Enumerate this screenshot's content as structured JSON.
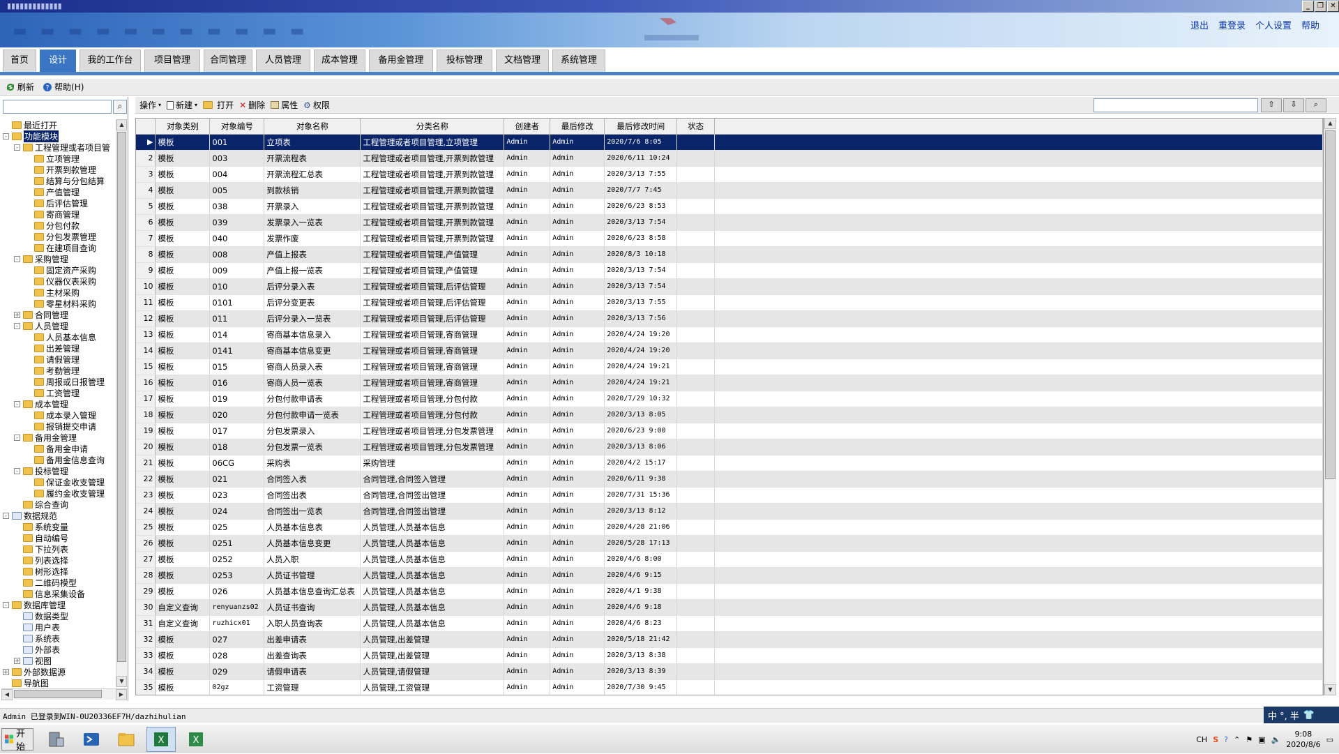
{
  "window": {
    "minimize": "_",
    "restore": "❐",
    "close": "✕"
  },
  "header": {
    "links": [
      "退出",
      "重登录",
      "个人设置",
      "帮助"
    ]
  },
  "nav": {
    "tabs": [
      "首页",
      "设计",
      "我的工作台",
      "项目管理",
      "合同管理",
      "人员管理",
      "成本管理",
      "备用金管理",
      "投标管理",
      "文档管理",
      "系统管理"
    ],
    "active": 1
  },
  "toolbar": {
    "refresh": "刷新",
    "help": "帮助(H)"
  },
  "toolbar2": {
    "operate": "操作",
    "new": "新建",
    "open": "打开",
    "delete": "删除",
    "props": "属性",
    "perm": "权限"
  },
  "tree": [
    {
      "label": "最近打开",
      "level": 0,
      "tw": "none",
      "type": "folder"
    },
    {
      "label": "功能模块",
      "level": 0,
      "tw": "-",
      "type": "folder",
      "sel": true
    },
    {
      "label": "工程管理或者项目管",
      "level": 1,
      "tw": "-",
      "type": "folder"
    },
    {
      "label": "立项管理",
      "level": 2,
      "tw": "none",
      "type": "folder"
    },
    {
      "label": "开票到款管理",
      "level": 2,
      "tw": "none",
      "type": "folder"
    },
    {
      "label": "结算与分包结算",
      "level": 2,
      "tw": "none",
      "type": "folder"
    },
    {
      "label": "产值管理",
      "level": 2,
      "tw": "none",
      "type": "folder"
    },
    {
      "label": "后评估管理",
      "level": 2,
      "tw": "none",
      "type": "folder"
    },
    {
      "label": "寄商管理",
      "level": 2,
      "tw": "none",
      "type": "folder"
    },
    {
      "label": "分包付款",
      "level": 2,
      "tw": "none",
      "type": "folder"
    },
    {
      "label": "分包发票管理",
      "level": 2,
      "tw": "none",
      "type": "folder"
    },
    {
      "label": "在建项目查询",
      "level": 2,
      "tw": "none",
      "type": "folder"
    },
    {
      "label": "采购管理",
      "level": 1,
      "tw": "-",
      "type": "folder"
    },
    {
      "label": "固定资产采购",
      "level": 2,
      "tw": "none",
      "type": "folder"
    },
    {
      "label": "仪器仪表采购",
      "level": 2,
      "tw": "none",
      "type": "folder"
    },
    {
      "label": "主材采购",
      "level": 2,
      "tw": "none",
      "type": "folder"
    },
    {
      "label": "零星材料采购",
      "level": 2,
      "tw": "none",
      "type": "folder"
    },
    {
      "label": "合同管理",
      "level": 1,
      "tw": "+",
      "type": "folder"
    },
    {
      "label": "人员管理",
      "level": 1,
      "tw": "-",
      "type": "folder"
    },
    {
      "label": "人员基本信息",
      "level": 2,
      "tw": "none",
      "type": "folder"
    },
    {
      "label": "出差管理",
      "level": 2,
      "tw": "none",
      "type": "folder"
    },
    {
      "label": "请假管理",
      "level": 2,
      "tw": "none",
      "type": "folder"
    },
    {
      "label": "考勤管理",
      "level": 2,
      "tw": "none",
      "type": "folder"
    },
    {
      "label": "周报或日报管理",
      "level": 2,
      "tw": "none",
      "type": "folder"
    },
    {
      "label": "工资管理",
      "level": 2,
      "tw": "none",
      "type": "folder"
    },
    {
      "label": "成本管理",
      "level": 1,
      "tw": "-",
      "type": "folder"
    },
    {
      "label": "成本录入管理",
      "level": 2,
      "tw": "none",
      "type": "folder"
    },
    {
      "label": "报销提交申请",
      "level": 2,
      "tw": "none",
      "type": "folder"
    },
    {
      "label": "备用金管理",
      "level": 1,
      "tw": "-",
      "type": "folder"
    },
    {
      "label": "备用金申请",
      "level": 2,
      "tw": "none",
      "type": "folder"
    },
    {
      "label": "备用金信息查询",
      "level": 2,
      "tw": "none",
      "type": "folder"
    },
    {
      "label": "投标管理",
      "level": 1,
      "tw": "-",
      "type": "folder"
    },
    {
      "label": "保证金收支管理",
      "level": 2,
      "tw": "none",
      "type": "folder"
    },
    {
      "label": "履约金收支管理",
      "level": 2,
      "tw": "none",
      "type": "folder"
    },
    {
      "label": "综合查询",
      "level": 1,
      "tw": "none",
      "type": "folder"
    },
    {
      "label": "数据规范",
      "level": 0,
      "tw": "-",
      "type": "doc"
    },
    {
      "label": "系统变量",
      "level": 1,
      "tw": "none",
      "type": "folder"
    },
    {
      "label": "自动编号",
      "level": 1,
      "tw": "none",
      "type": "folder"
    },
    {
      "label": "下拉列表",
      "level": 1,
      "tw": "none",
      "type": "folder"
    },
    {
      "label": "列表选择",
      "level": 1,
      "tw": "none",
      "type": "folder"
    },
    {
      "label": "树形选择",
      "level": 1,
      "tw": "none",
      "type": "folder"
    },
    {
      "label": "二维码模型",
      "level": 1,
      "tw": "none",
      "type": "folder"
    },
    {
      "label": "信息采集设备",
      "level": 1,
      "tw": "none",
      "type": "folder"
    },
    {
      "label": "数据库管理",
      "level": 0,
      "tw": "-",
      "type": "folder"
    },
    {
      "label": "数据类型",
      "level": 1,
      "tw": "none",
      "type": "doc"
    },
    {
      "label": "用户表",
      "level": 1,
      "tw": "none",
      "type": "doc"
    },
    {
      "label": "系统表",
      "level": 1,
      "tw": "none",
      "type": "doc"
    },
    {
      "label": "外部表",
      "level": 1,
      "tw": "none",
      "type": "doc"
    },
    {
      "label": "视图",
      "level": 1,
      "tw": "+",
      "type": "doc"
    },
    {
      "label": "外部数据源",
      "level": 0,
      "tw": "+",
      "type": "folder"
    },
    {
      "label": "导航图",
      "level": 0,
      "tw": "none",
      "type": "folder"
    }
  ],
  "table": {
    "columns": [
      "对象类别",
      "对象编号",
      "对象名称",
      "分类名称",
      "创建者",
      "最后修改",
      "最后修改时间",
      "状态"
    ],
    "rows": [
      [
        "模板",
        "001",
        "立项表",
        "工程管理或者项目管理,立项管理",
        "Admin",
        "Admin",
        "2020/7/6 8:05",
        ""
      ],
      [
        "模板",
        "003",
        "开票流程表",
        "工程管理或者项目管理,开票到款管理",
        "Admin",
        "Admin",
        "2020/6/11 10:24",
        ""
      ],
      [
        "模板",
        "004",
        "开票流程汇总表",
        "工程管理或者项目管理,开票到款管理",
        "Admin",
        "Admin",
        "2020/3/13 7:55",
        ""
      ],
      [
        "模板",
        "005",
        "到款核销",
        "工程管理或者项目管理,开票到款管理",
        "Admin",
        "Admin",
        "2020/7/7 7:45",
        ""
      ],
      [
        "模板",
        "038",
        "开票录入",
        "工程管理或者项目管理,开票到款管理",
        "Admin",
        "Admin",
        "2020/6/23 8:53",
        ""
      ],
      [
        "模板",
        "039",
        "发票录入一览表",
        "工程管理或者项目管理,开票到款管理",
        "Admin",
        "Admin",
        "2020/3/13 7:54",
        ""
      ],
      [
        "模板",
        "040",
        "发票作废",
        "工程管理或者项目管理,开票到款管理",
        "Admin",
        "Admin",
        "2020/6/23 8:58",
        ""
      ],
      [
        "模板",
        "008",
        "产值上报表",
        "工程管理或者项目管理,产值管理",
        "Admin",
        "Admin",
        "2020/8/3 10:18",
        ""
      ],
      [
        "模板",
        "009",
        "产值上报一览表",
        "工程管理或者项目管理,产值管理",
        "Admin",
        "Admin",
        "2020/3/13 7:54",
        ""
      ],
      [
        "模板",
        "010",
        "后评分录入表",
        "工程管理或者项目管理,后评估管理",
        "Admin",
        "Admin",
        "2020/3/13 7:54",
        ""
      ],
      [
        "模板",
        "0101",
        "后评分变更表",
        "工程管理或者项目管理,后评估管理",
        "Admin",
        "Admin",
        "2020/3/13 7:55",
        ""
      ],
      [
        "模板",
        "011",
        "后评分录入一览表",
        "工程管理或者项目管理,后评估管理",
        "Admin",
        "Admin",
        "2020/3/13 7:56",
        ""
      ],
      [
        "模板",
        "014",
        "寄商基本信息录入",
        "工程管理或者项目管理,寄商管理",
        "Admin",
        "Admin",
        "2020/4/24 19:20",
        ""
      ],
      [
        "模板",
        "0141",
        "寄商基本信息变更",
        "工程管理或者项目管理,寄商管理",
        "Admin",
        "Admin",
        "2020/4/24 19:20",
        ""
      ],
      [
        "模板",
        "015",
        "寄商人员录入表",
        "工程管理或者项目管理,寄商管理",
        "Admin",
        "Admin",
        "2020/4/24 19:21",
        ""
      ],
      [
        "模板",
        "016",
        "寄商人员一览表",
        "工程管理或者项目管理,寄商管理",
        "Admin",
        "Admin",
        "2020/4/24 19:21",
        ""
      ],
      [
        "模板",
        "019",
        "分包付款申请表",
        "工程管理或者项目管理,分包付款",
        "Admin",
        "Admin",
        "2020/7/29 10:32",
        ""
      ],
      [
        "模板",
        "020",
        "分包付款申请一览表",
        "工程管理或者项目管理,分包付款",
        "Admin",
        "Admin",
        "2020/3/13 8:05",
        ""
      ],
      [
        "模板",
        "017",
        "分包发票录入",
        "工程管理或者项目管理,分包发票管理",
        "Admin",
        "Admin",
        "2020/6/23 9:00",
        ""
      ],
      [
        "模板",
        "018",
        "分包发票一览表",
        "工程管理或者项目管理,分包发票管理",
        "Admin",
        "Admin",
        "2020/3/13 8:06",
        ""
      ],
      [
        "模板",
        "06CG",
        "采购表",
        "采购管理",
        "Admin",
        "Admin",
        "2020/4/2 15:17",
        ""
      ],
      [
        "模板",
        "021",
        "合同签入表",
        "合同管理,合同签入管理",
        "Admin",
        "Admin",
        "2020/6/11 9:38",
        ""
      ],
      [
        "模板",
        "023",
        "合同签出表",
        "合同管理,合同签出管理",
        "Admin",
        "Admin",
        "2020/7/31 15:36",
        ""
      ],
      [
        "模板",
        "024",
        "合同签出一览表",
        "合同管理,合同签出管理",
        "Admin",
        "Admin",
        "2020/3/13 8:12",
        ""
      ],
      [
        "模板",
        "025",
        "人员基本信息表",
        "人员管理,人员基本信息",
        "Admin",
        "Admin",
        "2020/4/28 21:06",
        ""
      ],
      [
        "模板",
        "0251",
        "人员基本信息变更",
        "人员管理,人员基本信息",
        "Admin",
        "Admin",
        "2020/5/28 17:13",
        ""
      ],
      [
        "模板",
        "0252",
        "人员入职",
        "人员管理,人员基本信息",
        "Admin",
        "Admin",
        "2020/4/6 8:00",
        ""
      ],
      [
        "模板",
        "0253",
        "人员证书管理",
        "人员管理,人员基本信息",
        "Admin",
        "Admin",
        "2020/4/6 9:15",
        ""
      ],
      [
        "模板",
        "026",
        "人员基本信息查询汇总表",
        "人员管理,人员基本信息",
        "Admin",
        "Admin",
        "2020/4/1 9:38",
        ""
      ],
      [
        "自定义查询",
        "renyuanzs02",
        "人员证书查询",
        "人员管理,人员基本信息",
        "Admin",
        "Admin",
        "2020/4/6 9:18",
        ""
      ],
      [
        "自定义查询",
        "ruzhicx01",
        "入职人员查询表",
        "人员管理,人员基本信息",
        "Admin",
        "Admin",
        "2020/4/6 8:23",
        ""
      ],
      [
        "模板",
        "027",
        "出差申请表",
        "人员管理,出差管理",
        "Admin",
        "Admin",
        "2020/5/18 21:42",
        ""
      ],
      [
        "模板",
        "028",
        "出差查询表",
        "人员管理,出差管理",
        "Admin",
        "Admin",
        "2020/3/13 8:38",
        ""
      ],
      [
        "模板",
        "029",
        "请假申请表",
        "人员管理,请假管理",
        "Admin",
        "Admin",
        "2020/3/13 8:39",
        ""
      ],
      [
        "模板",
        "02gz",
        "工资管理",
        "人员管理,工资管理",
        "Admin",
        "Admin",
        "2020/7/30 9:45",
        ""
      ]
    ]
  },
  "status": {
    "text": "Admin 已登录到WIN-0U20336EF7H/dazhihulian"
  },
  "ime": {
    "text": "中 °, 半"
  },
  "taskbar": {
    "start": "开始",
    "lang": "CH",
    "time": "9:08",
    "date": "2020/8/6"
  }
}
